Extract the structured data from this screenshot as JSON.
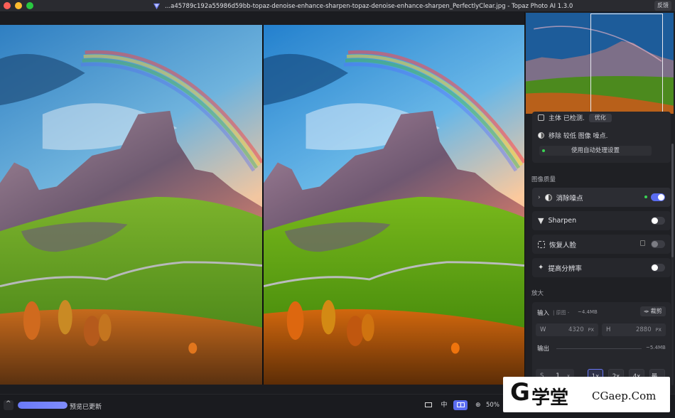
{
  "window": {
    "title": "...a45789c192a55986d59bb-topaz-denoise-enhance-sharpen-topaz-denoise-enhance-sharpen_PerfectlyClear.jpg - Topaz Photo AI 1.3.0",
    "feedback_label": "反馈"
  },
  "sidebar": {
    "auto": {
      "subject_label": "主体 已检测.",
      "subject_button": "优化",
      "remove_label": "移除 较低 图像 噪点.",
      "auto_settings_button": "使用自动处理设置"
    },
    "image_quality_label": "图像质量",
    "models": [
      {
        "label": "消除噪点",
        "enabled": true,
        "icon": "denoise-icon"
      },
      {
        "label": "Sharpen",
        "enabled": false,
        "icon": "sharpen-icon"
      },
      {
        "label": "恢复人脸",
        "enabled": false,
        "icon": "face-recovery-icon"
      },
      {
        "label": "提高分辨率",
        "enabled": false,
        "icon": "upscale-icon"
      }
    ],
    "upscale": {
      "section_label": "放大",
      "input_label": "输入",
      "input_note": "| 原图 -",
      "input_size": "~4.4MB",
      "crop_button": "裁剪",
      "width_label": "W",
      "width_value": "4320",
      "width_unit": "PX",
      "height_label": "H",
      "height_value": "2880",
      "height_unit": "PX",
      "output_label": "输出",
      "output_size": "~5.4MB",
      "scale_label": "S",
      "scale_value": "1",
      "scale_unit": "x",
      "scale_options": [
        "1x",
        "2x",
        "4x",
        "最..."
      ],
      "selected_scale": "1x"
    }
  },
  "bottom_bar": {
    "progress_percent": 100,
    "status_text": "预览已更新",
    "view_single_icon": "single-view-icon",
    "view_center_label": "中",
    "view_split_icon": "split-view-icon",
    "zoom_icon": "zoom-icon",
    "zoom_level": "50%"
  },
  "watermark": {
    "logo_glyph": "G",
    "name": "学堂",
    "site": "CGaep.Com"
  },
  "colors": {
    "accent": "#5a6cf0",
    "active_dot": "#39d353",
    "panel_bg": "#1f2024"
  }
}
